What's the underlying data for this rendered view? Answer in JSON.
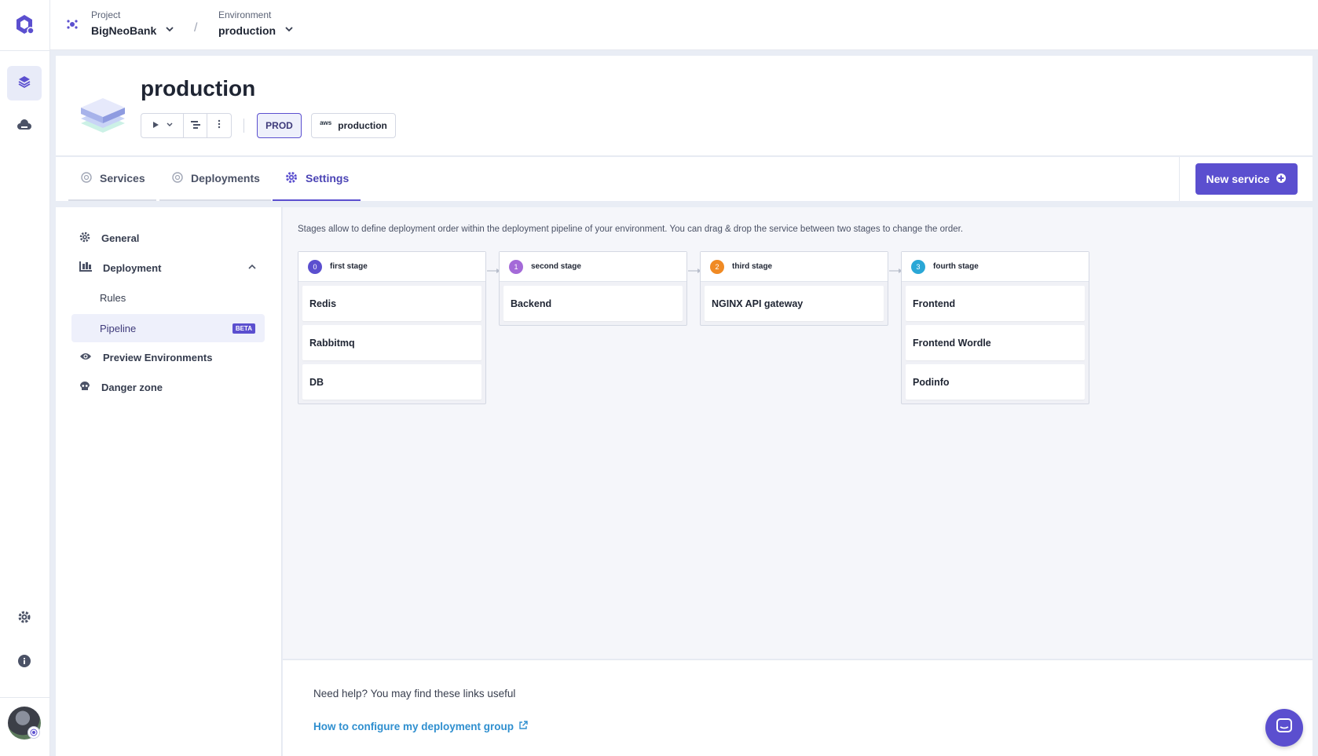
{
  "colors": {
    "accent": "#5b4fcf",
    "link": "#2f8fcf"
  },
  "topbar": {
    "project_label": "Project",
    "project_value": "BigNeoBank",
    "separator": "/",
    "environment_label": "Environment",
    "environment_value": "production"
  },
  "header": {
    "title": "production",
    "mode_badge": "PROD",
    "cluster_provider": "aws",
    "cluster_name": "production"
  },
  "tabs": [
    {
      "label": "Services",
      "icon": "status-circle-icon"
    },
    {
      "label": "Deployments",
      "icon": "status-circle-icon"
    },
    {
      "label": "Settings",
      "icon": "gear-icon",
      "active": true
    }
  ],
  "new_service_label": "New service",
  "settings_nav": {
    "general": "General",
    "deployment": "Deployment",
    "rules": "Rules",
    "pipeline": "Pipeline",
    "beta": "BETA",
    "preview": "Preview Environments",
    "danger": "Danger zone"
  },
  "pipeline": {
    "description": "Stages allow to define deployment order within the deployment pipeline of your environment. You can drag & drop the service between two stages to change the order.",
    "stages": [
      {
        "number": "0",
        "name": "first stage",
        "color": "#5b4fcf",
        "services": [
          "Redis",
          "Rabbitmq",
          "DB"
        ]
      },
      {
        "number": "1",
        "name": "second stage",
        "color": "#a46ad8",
        "services": [
          "Backend"
        ]
      },
      {
        "number": "2",
        "name": "third stage",
        "color": "#f08a24",
        "services": [
          "NGINX API gateway"
        ]
      },
      {
        "number": "3",
        "name": "fourth stage",
        "color": "#2aa7d6",
        "services": [
          "Frontend",
          "Frontend Wordle",
          "Podinfo"
        ]
      }
    ]
  },
  "help": {
    "title": "Need help? You may find these links useful",
    "link": "How to configure my deployment group"
  }
}
